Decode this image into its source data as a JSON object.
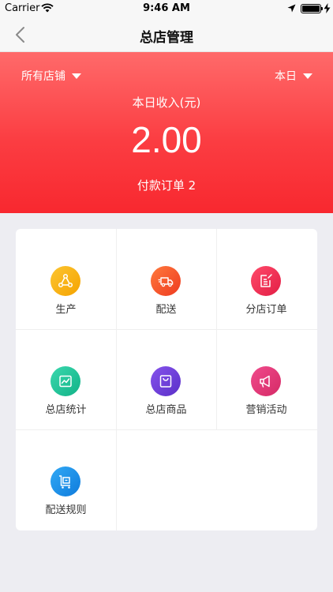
{
  "status_bar": {
    "carrier": "Carrier",
    "time": "9:46 AM"
  },
  "nav": {
    "title": "总店管理"
  },
  "summary": {
    "store_filter": "所有店铺",
    "date_filter": "本日",
    "income_label": "本日收入(元)",
    "income_value": "2.00",
    "paid_orders": "付款订单 2"
  },
  "colors": {
    "header_red": "#fb3d42",
    "production": "#f9b40a",
    "delivery": "#f4542d",
    "branch_orders": "#ee2e52",
    "statistics": "#22c59a",
    "products": "#6b3fd6",
    "marketing": "#e33a7a",
    "delivery_rules": "#1d8fe8"
  },
  "menu": [
    {
      "label": "生产",
      "icon": "production-flow-icon"
    },
    {
      "label": "配送",
      "icon": "delivery-truck-icon"
    },
    {
      "label": "分店订单",
      "icon": "order-note-icon"
    },
    {
      "label": "总店统计",
      "icon": "statistics-chart-icon"
    },
    {
      "label": "总店商品",
      "icon": "shopping-bag-icon"
    },
    {
      "label": "营销活动",
      "icon": "megaphone-icon"
    },
    {
      "label": "配送规则",
      "icon": "cart-rules-icon"
    }
  ]
}
